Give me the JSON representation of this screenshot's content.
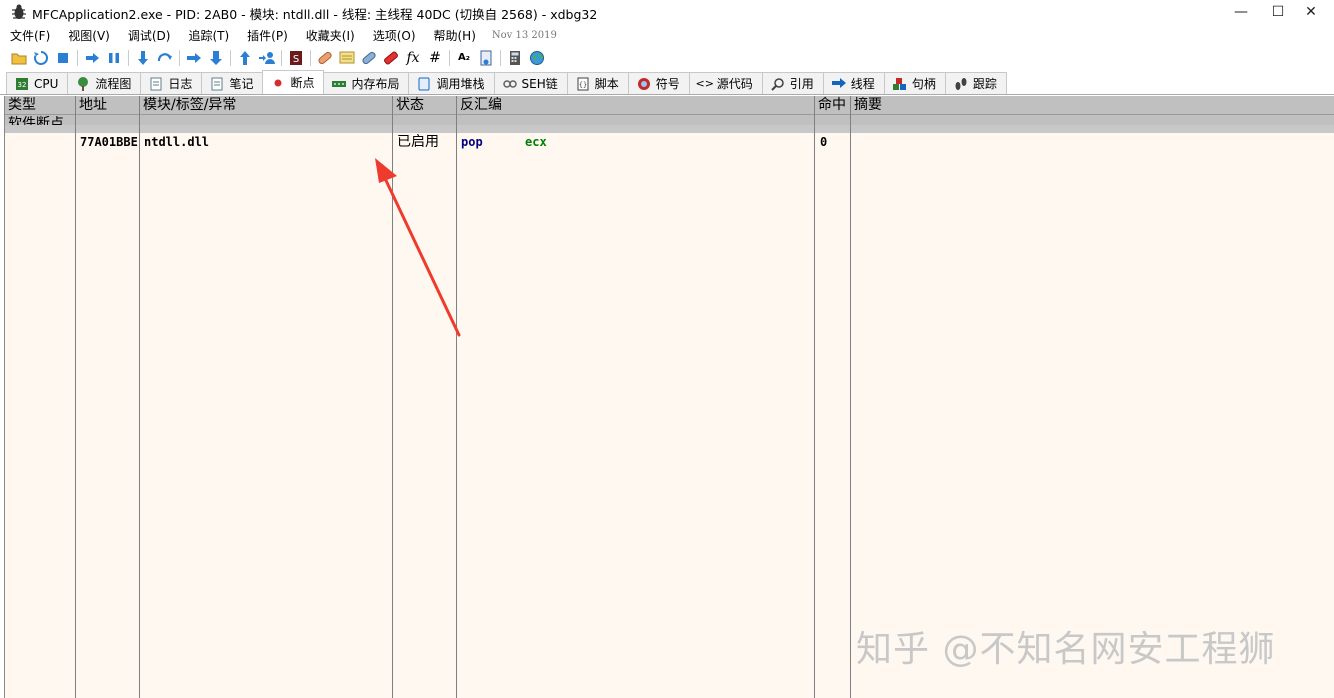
{
  "window": {
    "title": "MFCApplication2.exe - PID: 2AB0 - 模块: ntdll.dll - 线程: 主线程 40DC (切换自 2568) - xdbg32",
    "minimize": "—",
    "maximize": "☐",
    "close": "✕"
  },
  "menu": {
    "items": [
      "文件(F)",
      "视图(V)",
      "调试(D)",
      "追踪(T)",
      "插件(P)",
      "收藏夹(I)",
      "选项(O)",
      "帮助(H)"
    ],
    "date": "Nov 13 2019"
  },
  "toolbar": {
    "icons": [
      "open-icon",
      "restart-icon",
      "stop-icon",
      "run-icon",
      "pause-icon",
      "step-into-icon",
      "step-over-icon",
      "trace-into-icon",
      "trace-over-icon",
      "execute-till-return-icon",
      "run-to-user-code-icon",
      "scylla-icon",
      "patch-icon",
      "comment-icon",
      "label-icon",
      "bookmark-icon",
      "function-icon",
      "hash-icon",
      "font-icon",
      "document-icon",
      "calculator-icon",
      "globe-icon"
    ]
  },
  "tabs": [
    {
      "label": "CPU",
      "icon": "cpu-icon",
      "color": "#2e7d32"
    },
    {
      "label": "流程图",
      "icon": "tree-icon",
      "color": "#388e3c"
    },
    {
      "label": "日志",
      "icon": "log-icon",
      "color": "#607d8b"
    },
    {
      "label": "笔记",
      "icon": "notes-icon",
      "color": "#607d8b"
    },
    {
      "label": "断点",
      "icon": "breakpoint-icon",
      "color": "#d32f2f"
    },
    {
      "label": "内存布局",
      "icon": "memory-icon",
      "color": "#2e7d32"
    },
    {
      "label": "调用堆栈",
      "icon": "callstack-icon",
      "color": "#1565c0"
    },
    {
      "label": "SEH链",
      "icon": "seh-icon",
      "color": "#616161"
    },
    {
      "label": "脚本",
      "icon": "script-icon",
      "color": "#424242"
    },
    {
      "label": "符号",
      "icon": "symbol-icon",
      "color": "#c62828"
    },
    {
      "label": "源代码",
      "icon": "source-icon",
      "color": "#424242"
    },
    {
      "label": "引用",
      "icon": "reference-icon",
      "color": "#424242"
    },
    {
      "label": "线程",
      "icon": "thread-icon",
      "color": "#1565c0"
    },
    {
      "label": "句柄",
      "icon": "handle-icon",
      "color": "#2e7d32"
    },
    {
      "label": "跟踪",
      "icon": "trace-icon",
      "color": "#424242"
    }
  ],
  "active_tab": "断点",
  "columns": [
    "类型",
    "地址",
    "模块/标签/异常",
    "状态",
    "反汇编",
    "命中",
    "摘要"
  ],
  "group": "软件断点",
  "rows": [
    {
      "type": "",
      "address": "77A01BBE",
      "module": "ntdll.dll",
      "status": "已启用",
      "mnemonic": "pop",
      "operand": "ecx",
      "hits": "0",
      "summary": ""
    }
  ],
  "colors": {
    "grid_bg": "#fff8f0",
    "header_bg": "#c0c0c0",
    "mnemonic": "#000080",
    "operand": "#008000",
    "arrow": "#ef3b2d"
  },
  "watermark": "知乎 @不知名网安工程狮"
}
